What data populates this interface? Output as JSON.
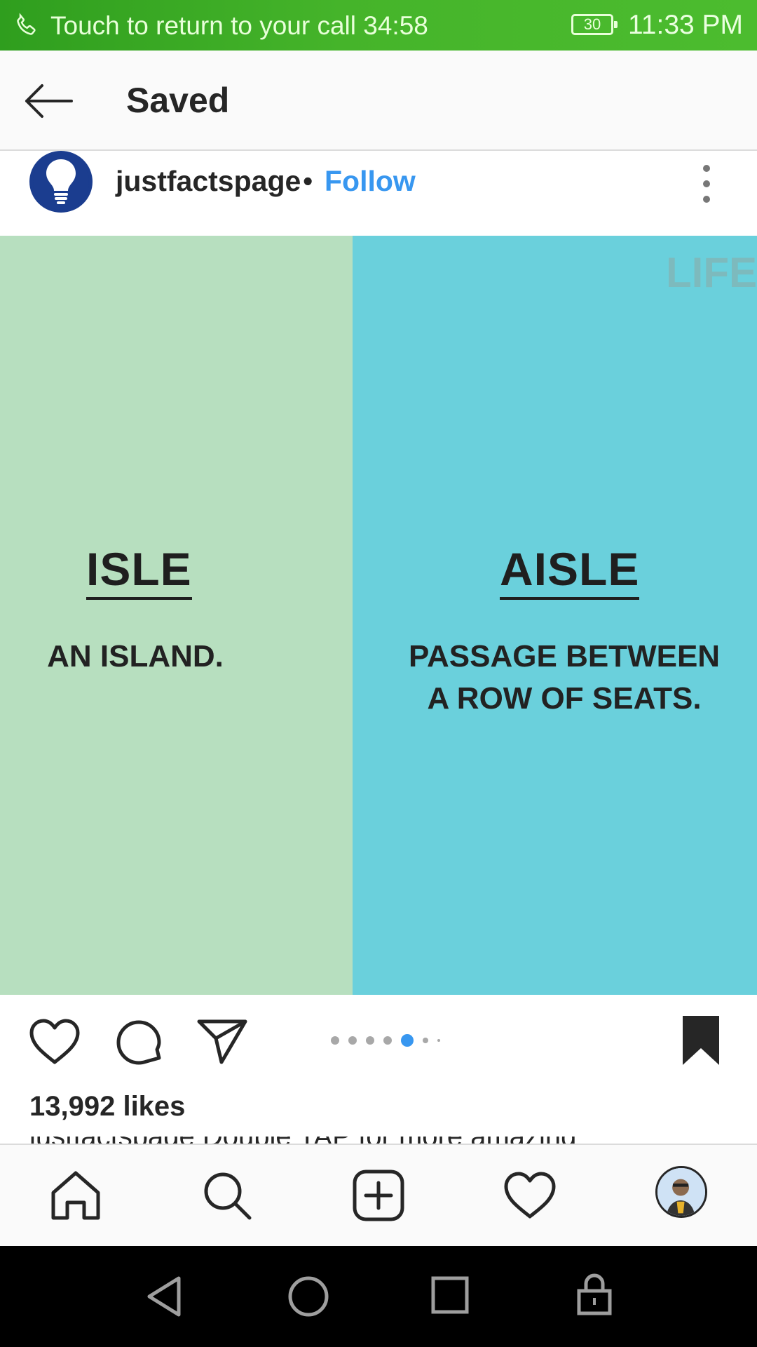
{
  "status_bar": {
    "call_text": "Touch to return to your call",
    "call_timer": "34:58",
    "battery": "30",
    "time": "11:33 PM"
  },
  "header": {
    "title": "Saved",
    "back_icon": "arrow-left-icon"
  },
  "post": {
    "username": "justfactspage",
    "separator": "•",
    "follow_label": "Follow",
    "more_icon": "more-vertical-icon",
    "image": {
      "left_word": "ISLE",
      "left_definition": "AN ISLAND.",
      "right_word": "AISLE",
      "right_definition_line1": "PASSAGE BETWEEN",
      "right_definition_line2": "A ROW OF SEATS.",
      "watermark": "LIFE",
      "left_color": "#b7dfbf",
      "right_color": "#6ad0dc"
    },
    "carousel": {
      "count": 7,
      "active_index": 4,
      "active_color": "#3897f0"
    },
    "likes": "13,992 likes",
    "caption_peek": "justfactspage Double TAP for more amazing"
  },
  "bottom_nav": [
    "home-icon",
    "search-icon",
    "add-post-icon",
    "activity-heart-icon",
    "profile-avatar"
  ],
  "system_nav": [
    "back-triangle-icon",
    "home-circle-icon",
    "recents-square-icon",
    "lock-icon"
  ]
}
